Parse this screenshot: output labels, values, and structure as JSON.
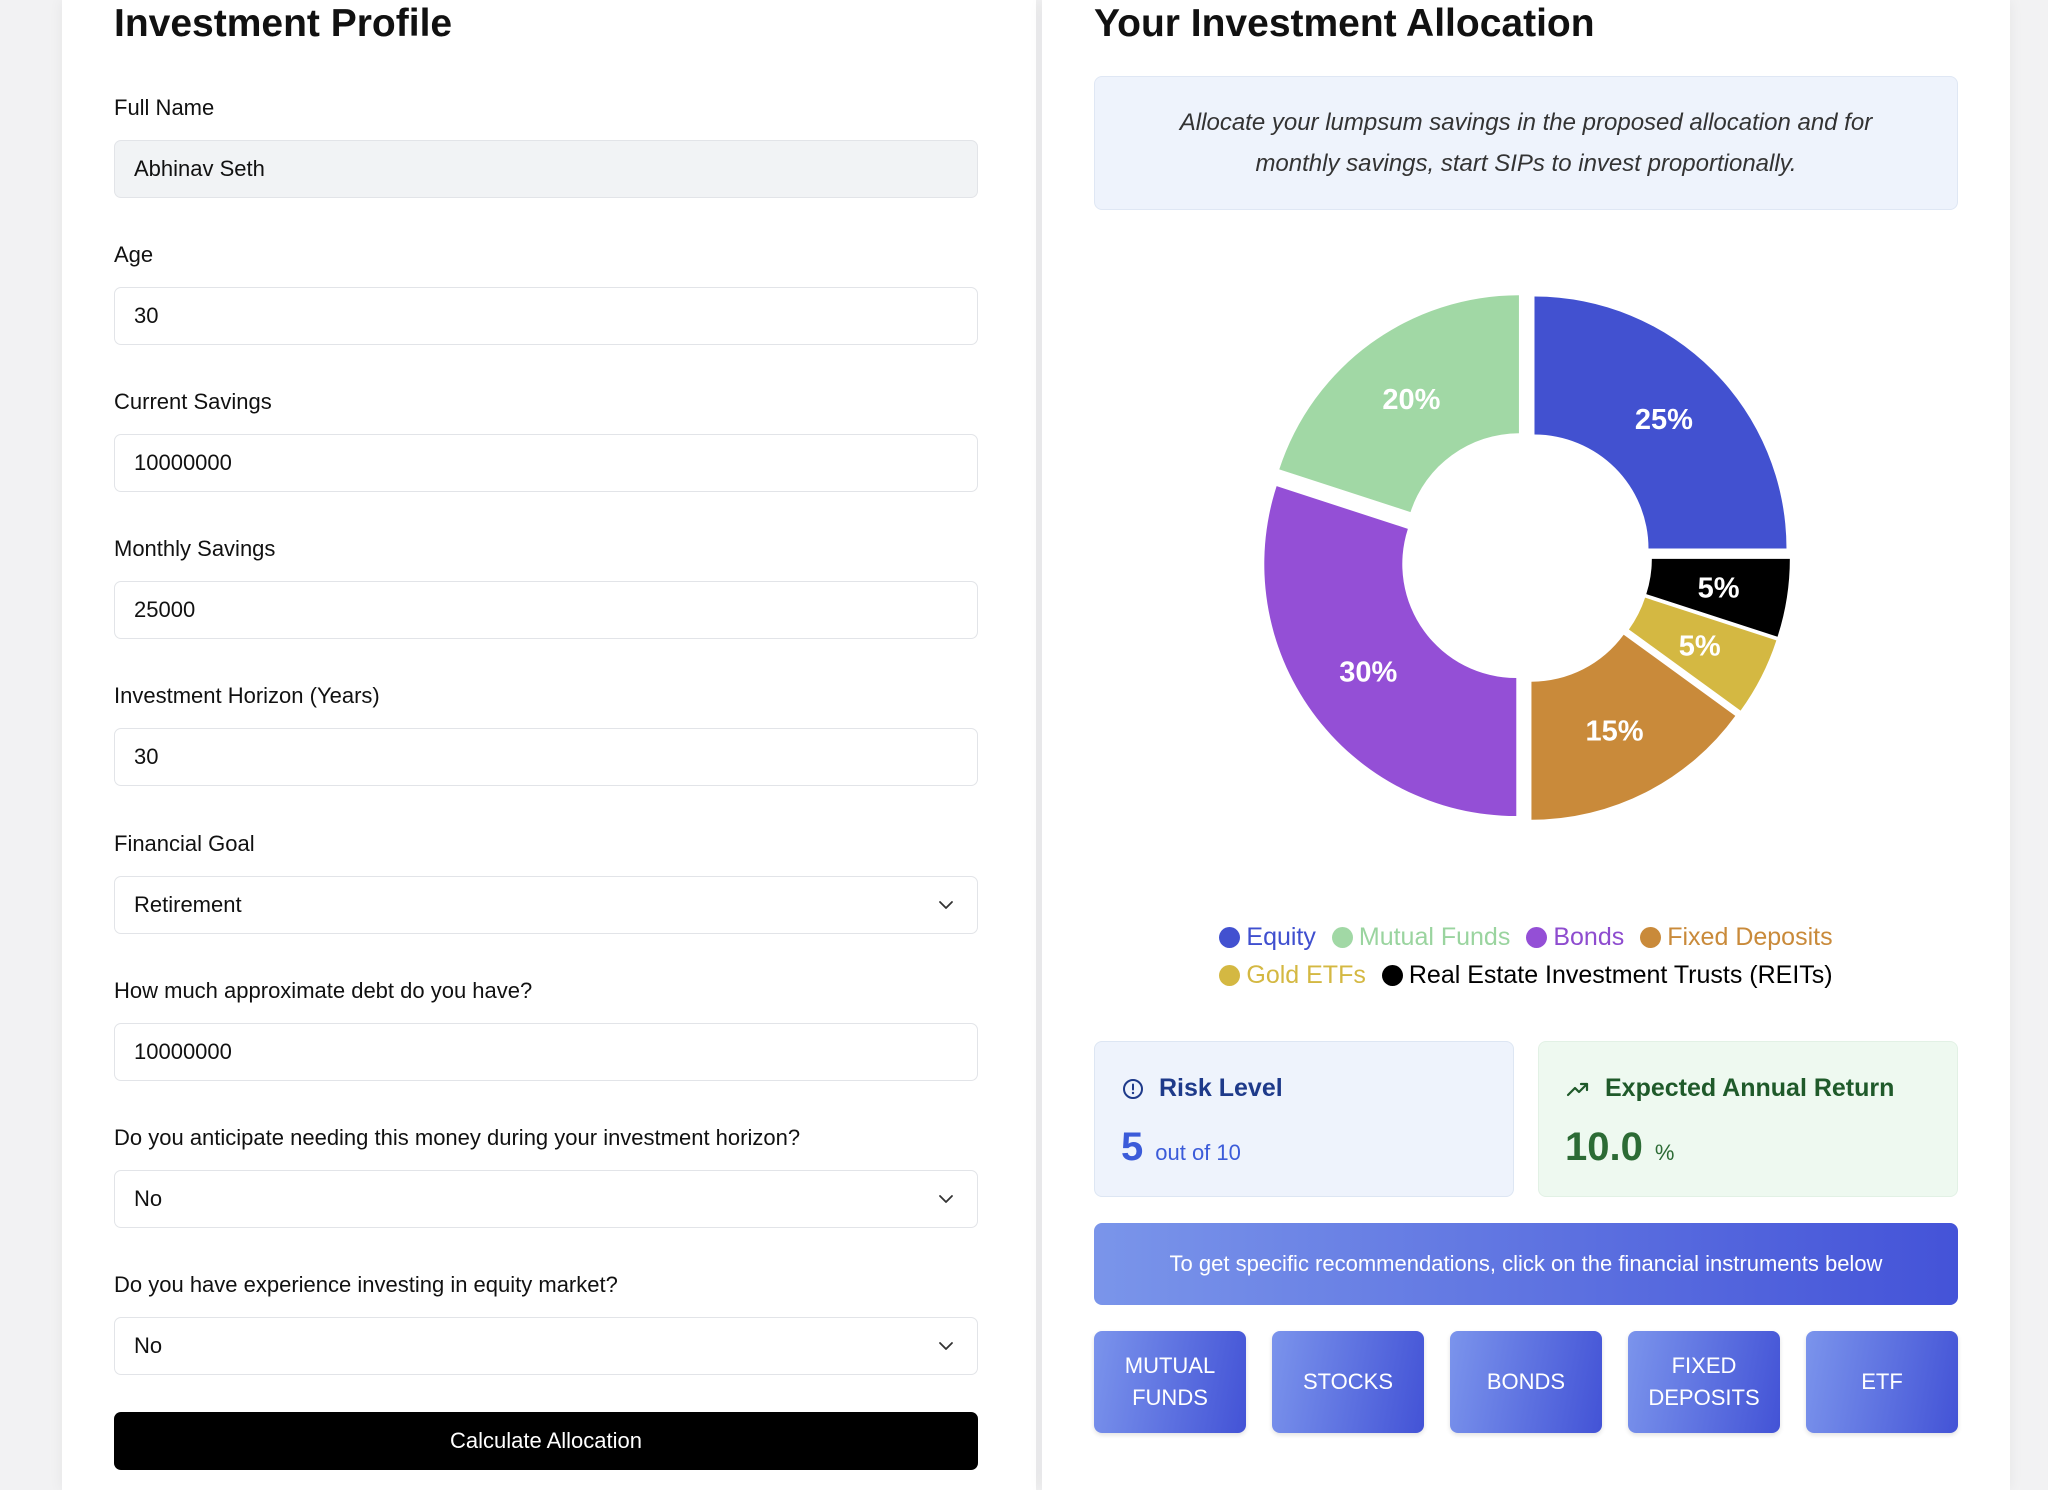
{
  "profile": {
    "title": "Investment Profile",
    "fields": [
      {
        "label": "Full Name",
        "value": "Abhinav Seth"
      },
      {
        "label": "Age",
        "value": "30"
      },
      {
        "label": "Current Savings",
        "value": "10000000"
      },
      {
        "label": "Monthly Savings",
        "value": "25000"
      },
      {
        "label": "Investment Horizon (Years)",
        "value": "30"
      },
      {
        "label": "Financial Goal",
        "value": "Retirement"
      },
      {
        "label": "How much approximate debt do you have?",
        "value": "10000000"
      },
      {
        "label": "Do you anticipate needing this money during your investment horizon?",
        "value": "No"
      },
      {
        "label": "Do you have experience investing in equity market?",
        "value": "No"
      }
    ],
    "calculate_label": "Calculate Allocation"
  },
  "allocation": {
    "title": "Your Investment Allocation",
    "info_text": "Allocate your lumpsum savings in the proposed allocation and for monthly savings, start SIPs to invest proportionally.",
    "risk": {
      "title": "Risk Level",
      "value": "5",
      "suffix": "out of 10",
      "icon": "alert-circle-icon"
    },
    "return": {
      "title": "Expected Annual Return",
      "value": "10.0",
      "suffix": "%",
      "icon": "trending-up-icon"
    },
    "recommendation_text": "To get specific recommendations, click on the financial instruments below",
    "instruments": [
      "MUTUAL FUNDS",
      "STOCKS",
      "BONDS",
      "FIXED DEPOSITS",
      "ETF"
    ]
  },
  "chart_data": {
    "type": "pie",
    "series": [
      {
        "name": "Equity",
        "value": 25,
        "label": "25%",
        "color": "#4251d0"
      },
      {
        "name": "Real Estate Investment Trusts (REITs)",
        "value": 5,
        "label": "5%",
        "color": "#000000"
      },
      {
        "name": "Gold ETFs",
        "value": 5,
        "label": "5%",
        "color": "#d4b842"
      },
      {
        "name": "Fixed Deposits",
        "value": 15,
        "label": "15%",
        "color": "#c98a3a"
      },
      {
        "name": "Bonds",
        "value": 30,
        "label": "30%",
        "color": "#944fd6"
      },
      {
        "name": "Mutual Funds",
        "value": 20,
        "label": "20%",
        "color": "#a1d8a5"
      }
    ],
    "legend": [
      {
        "name": "Equity",
        "color": "#4251d0"
      },
      {
        "name": "Mutual Funds",
        "color": "#a1d8a5"
      },
      {
        "name": "Bonds",
        "color": "#944fd6"
      },
      {
        "name": "Fixed Deposits",
        "color": "#c98a3a"
      },
      {
        "name": "Gold ETFs",
        "color": "#d4b842"
      },
      {
        "name": "Real Estate Investment Trusts (REITs)",
        "color": "#000000"
      }
    ],
    "legend_text_colors": {
      "Equity": "#3f4fcf",
      "Mutual Funds": "#9ad49f",
      "Bonds": "#8e4ccf",
      "Fixed Deposits": "#c98a3a",
      "Gold ETFs": "#d4b842",
      "Real Estate Investment Trusts (REITs)": "#000000"
    }
  }
}
